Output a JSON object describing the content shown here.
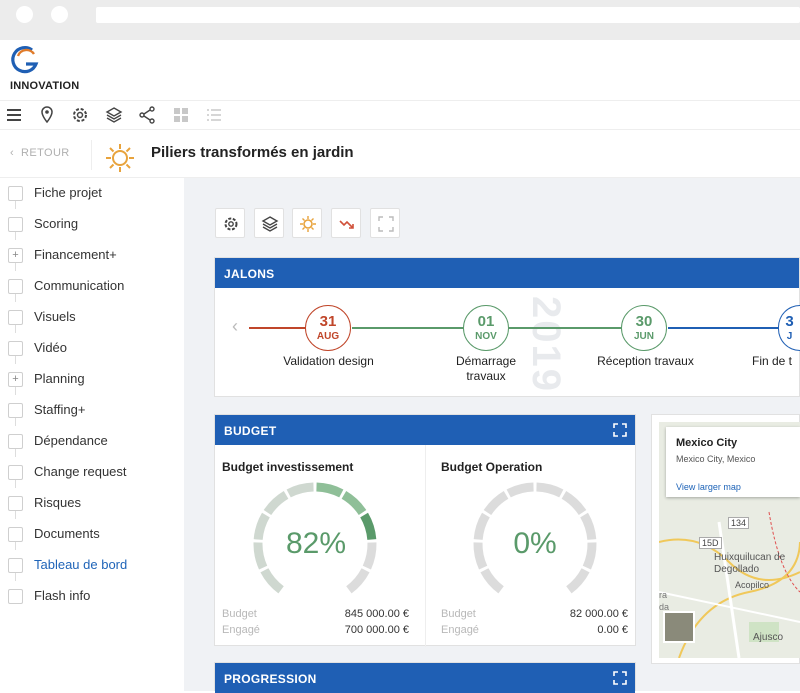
{
  "brand": {
    "name": "INNOVATION",
    "accent": "#1f5fb4"
  },
  "toolbar": {
    "icons": [
      "menu-icon",
      "location-pin-icon",
      "gear-icon",
      "layers-icon",
      "share-icon",
      "grid-icon",
      "list-icon"
    ]
  },
  "header": {
    "back_label": "RETOUR",
    "title": "Piliers transformés en jardin"
  },
  "sidebar": {
    "items": [
      {
        "label": "Fiche projet",
        "expand": false,
        "active": false
      },
      {
        "label": "Scoring",
        "expand": false,
        "active": false
      },
      {
        "label": "Financement+",
        "expand": true,
        "active": false
      },
      {
        "label": "Communication",
        "expand": false,
        "active": false
      },
      {
        "label": "Visuels",
        "expand": false,
        "active": false
      },
      {
        "label": "Vidéo",
        "expand": false,
        "active": false
      },
      {
        "label": "Planning",
        "expand": true,
        "active": false
      },
      {
        "label": "Staffing+",
        "expand": false,
        "active": false
      },
      {
        "label": "Dépendance",
        "expand": false,
        "active": false
      },
      {
        "label": "Change request",
        "expand": false,
        "active": false
      },
      {
        "label": "Risques",
        "expand": false,
        "active": false
      },
      {
        "label": "Documents",
        "expand": false,
        "active": false
      },
      {
        "label": "Tableau de bord",
        "expand": false,
        "active": true
      },
      {
        "label": "Flash info",
        "expand": false,
        "active": false
      }
    ]
  },
  "jalons": {
    "title": "JALONS",
    "year": "2019",
    "milestones": [
      {
        "day": "31",
        "month": "AUG",
        "label": "Validation design",
        "color": "#c0462a"
      },
      {
        "day": "01",
        "month": "NOV",
        "label": "Démarrage travaux",
        "color": "#5a9a6a"
      },
      {
        "day": "30",
        "month": "JUN",
        "label": "Réception travaux",
        "color": "#5a9a6a"
      },
      {
        "day": "3",
        "month": "J",
        "label": "Fin de t",
        "color": "#1f5fb4"
      }
    ]
  },
  "budget": {
    "title": "BUDGET",
    "invest": {
      "title": "Budget investissement",
      "percent": 82,
      "percent_label": "82%",
      "budget_label": "Budget",
      "budget_value": "845 000.00 €",
      "engage_label": "Engagé",
      "engage_value": "700 000.00 €"
    },
    "operation": {
      "title": "Budget Operation",
      "percent": 0,
      "percent_label": "0%",
      "budget_label": "Budget",
      "budget_value": "82 000.00 €",
      "engage_label": "Engagé",
      "engage_value": "0.00 €"
    }
  },
  "map": {
    "place": "Mexico City",
    "address": "Mexico City, Mexico",
    "link": "View larger map",
    "labels": [
      "134",
      "15D",
      "Huixquilucan de Degollado",
      "Acopilco",
      "Ajusco",
      "ra",
      "da"
    ]
  },
  "progression": {
    "title": "PROGRESSION"
  }
}
